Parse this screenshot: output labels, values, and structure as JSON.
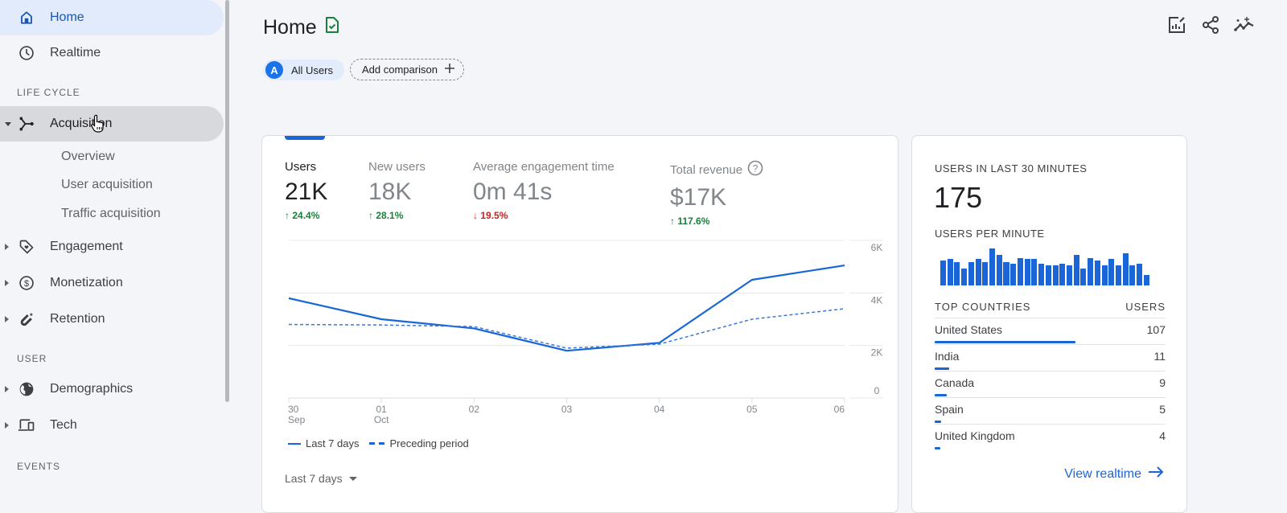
{
  "sidebar": {
    "items_top": [
      {
        "label": "Home",
        "icon": "home-icon",
        "state": "active"
      },
      {
        "label": "Realtime",
        "icon": "clock-icon"
      }
    ],
    "sections": {
      "lifecycle": "LIFE CYCLE",
      "user": "USER",
      "events": "EVENTS"
    },
    "lifecycle_items": [
      {
        "label": "Acquisition",
        "icon": "acquisition-icon",
        "expanded": true,
        "state": "hover"
      },
      {
        "label": "Engagement",
        "icon": "tag-icon"
      },
      {
        "label": "Monetization",
        "icon": "dollar-icon"
      },
      {
        "label": "Retention",
        "icon": "magnet-icon"
      }
    ],
    "acquisition_sub": [
      "Overview",
      "User acquisition",
      "Traffic acquisition"
    ],
    "user_items": [
      {
        "label": "Demographics",
        "icon": "globe-icon"
      },
      {
        "label": "Tech",
        "icon": "devices-icon"
      }
    ]
  },
  "header": {
    "title": "Home",
    "title_icon": "verified-report-icon",
    "actions": [
      "customize-report-icon",
      "share-icon",
      "insights-icon"
    ],
    "segment_chip": {
      "avatar": "A",
      "label": "All Users"
    },
    "add_comparison": "Add comparison"
  },
  "metrics": [
    {
      "label": "Users",
      "value": "21K",
      "delta": "24.4%",
      "direction": "up",
      "selected": true
    },
    {
      "label": "New users",
      "value": "18K",
      "delta": "28.1%",
      "direction": "up"
    },
    {
      "label": "Average engagement time",
      "value": "0m 41s",
      "delta": "19.5%",
      "direction": "down"
    },
    {
      "label": "Total revenue",
      "value": "$17K",
      "delta": "117.6%",
      "direction": "up",
      "help": true
    }
  ],
  "chart_data": {
    "type": "line",
    "title": "Users",
    "x": [
      "30\nSep",
      "01\nOct",
      "02",
      "03",
      "04",
      "05",
      "06"
    ],
    "x_ticks": [
      [
        "30",
        "Sep"
      ],
      [
        "01",
        "Oct"
      ],
      [
        "02",
        ""
      ],
      [
        "03",
        ""
      ],
      [
        "04",
        ""
      ],
      [
        "05",
        ""
      ],
      [
        "06",
        ""
      ]
    ],
    "y_ticks": [
      "0",
      "2K",
      "4K",
      "6K"
    ],
    "ylim": [
      0,
      6000
    ],
    "y_axis_side": "right",
    "grid": true,
    "series": [
      {
        "name": "Last 7 days",
        "style": "solid",
        "values": [
          3800,
          3000,
          2650,
          1800,
          2100,
          4500,
          5050
        ]
      },
      {
        "name": "Preceding period",
        "style": "dashed",
        "values": [
          2800,
          2780,
          2720,
          1900,
          2050,
          3000,
          3400
        ]
      }
    ],
    "legend_position": "bottom-left"
  },
  "date_range": "Last 7 days",
  "realtime": {
    "title": "USERS IN LAST 30 MINUTES",
    "count": "175",
    "per_minute_label": "USERS PER MINUTE",
    "per_minute": [
      8,
      8.5,
      7.5,
      5.5,
      7.5,
      8.5,
      7.5,
      12,
      10,
      7.5,
      7,
      9,
      8.5,
      8.5,
      7,
      6.5,
      6.5,
      7,
      6.5,
      10,
      5.5,
      9,
      8,
      6.5,
      8.5,
      6.5,
      10.5,
      6.5,
      7,
      3.5
    ],
    "countries_header": "TOP COUNTRIES",
    "users_header": "USERS",
    "countries": [
      {
        "name": "United States",
        "users": "107",
        "value": 107
      },
      {
        "name": "India",
        "users": "11",
        "value": 11
      },
      {
        "name": "Canada",
        "users": "9",
        "value": 9
      },
      {
        "name": "Spain",
        "users": "5",
        "value": 5
      },
      {
        "name": "United Kingdom",
        "users": "4",
        "value": 4
      }
    ],
    "view_link": "View realtime"
  },
  "colors": {
    "accent": "#1a66d9",
    "up": "#188038",
    "down": "#c5221f"
  }
}
